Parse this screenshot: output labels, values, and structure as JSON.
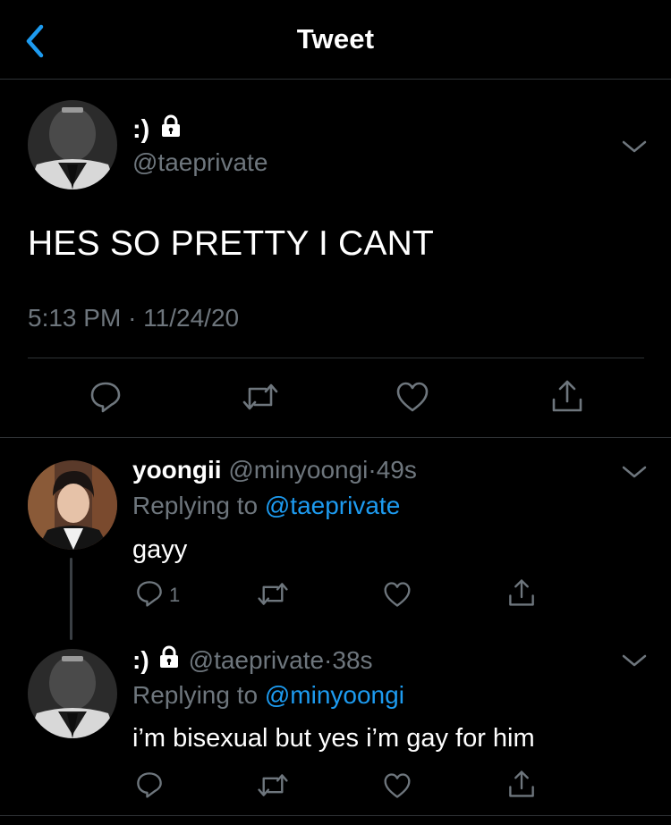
{
  "header": {
    "title": "Tweet"
  },
  "main_tweet": {
    "display_name": ":)",
    "handle": "@taeprivate",
    "text": "HES SO PRETTY I CANT",
    "time": "5:13 PM",
    "separator": "·",
    "date": "11/24/20"
  },
  "replies": [
    {
      "display_name": "yoongii",
      "handle": "@minyoongi",
      "separator": "·",
      "age": "49s",
      "replying_prefix": "Replying to",
      "replying_to": "@taeprivate",
      "text": "gayy",
      "reply_count": "1"
    },
    {
      "display_name": ":)",
      "handle": "@taeprivate",
      "separator": "·",
      "age": "38s",
      "replying_prefix": "Replying to",
      "replying_to": "@minyoongi",
      "text": "i’m bisexual but yes i’m gay for him",
      "reply_count": ""
    }
  ],
  "colors": {
    "background": "#000000",
    "text": "#ffffff",
    "muted": "#6e767d",
    "link": "#1d9bf0",
    "divider": "#2f3336"
  },
  "icons": [
    "back-chevron-icon",
    "lock-icon",
    "chevron-down-icon",
    "reply-icon",
    "retweet-icon",
    "like-icon",
    "share-icon"
  ]
}
